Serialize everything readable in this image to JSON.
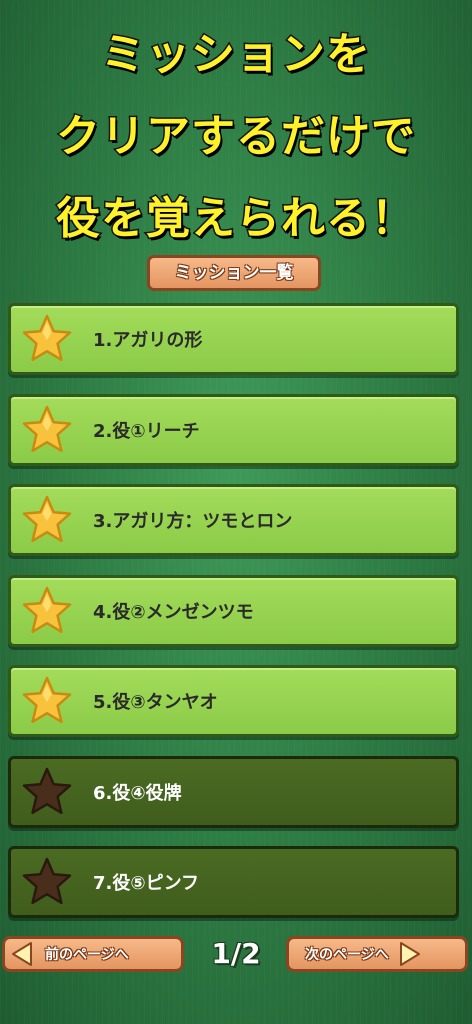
{
  "headline": {
    "line1": "ミッションを",
    "line2": "クリアするだけで",
    "line3": "役を覚えられる！"
  },
  "list_title": "ミッション一覧",
  "missions": [
    {
      "label": "1.アガリの形",
      "status": "cleared"
    },
    {
      "label": "2.役①リーチ",
      "status": "cleared"
    },
    {
      "label": "3.アガリ方：ツモとロン",
      "status": "cleared"
    },
    {
      "label": "4.役②メンゼンツモ",
      "status": "cleared"
    },
    {
      "label": "5.役③タンヤオ",
      "status": "cleared"
    },
    {
      "label": "6.役④役牌",
      "status": "locked"
    },
    {
      "label": "7.役⑤ピンフ",
      "status": "locked"
    }
  ],
  "pager": {
    "prev_label": "前のページへ",
    "next_label": "次のページへ",
    "indicator": "1/2"
  },
  "colors": {
    "background": "#2f7f46",
    "headline_text": "#fff22a",
    "mission_cleared": "#8bcb47",
    "mission_locked": "#405d1c",
    "star_gold": "#f9c23c",
    "star_dark": "#4a2e1c",
    "button_orange": "#e49561"
  },
  "icons": {
    "cleared": "gold-star-icon",
    "locked": "dark-star-icon",
    "prev": "arrow-left-icon",
    "next": "arrow-right-icon"
  }
}
